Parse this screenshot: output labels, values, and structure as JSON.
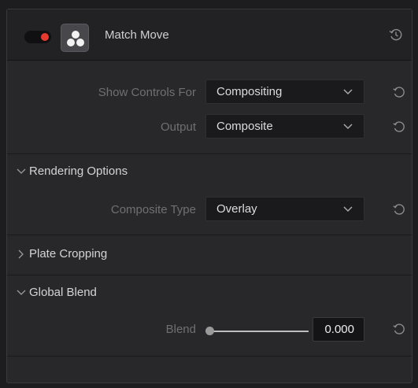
{
  "header": {
    "title": "Match Move",
    "enabled": true,
    "toggle_color": "#e63a2e",
    "fx_icon": "resolve-fusion-icon",
    "reset_icon": "keyframe-reset-icon"
  },
  "controls": {
    "show_controls_for": {
      "label": "Show Controls For",
      "value": "Compositing"
    },
    "output": {
      "label": "Output",
      "value": "Composite"
    }
  },
  "sections": {
    "rendering_options": {
      "title": "Rendering Options",
      "expanded": true,
      "composite_type": {
        "label": "Composite Type",
        "value": "Overlay"
      }
    },
    "plate_cropping": {
      "title": "Plate Cropping",
      "expanded": false
    },
    "global_blend": {
      "title": "Global Blend",
      "expanded": true,
      "blend": {
        "label": "Blend",
        "value": "0.000",
        "slider_fraction": 0.0
      }
    }
  },
  "icons": {
    "reset": "reset-icon",
    "chevron_down": "chevron-down-icon",
    "chevron_right": "chevron-right-icon"
  }
}
